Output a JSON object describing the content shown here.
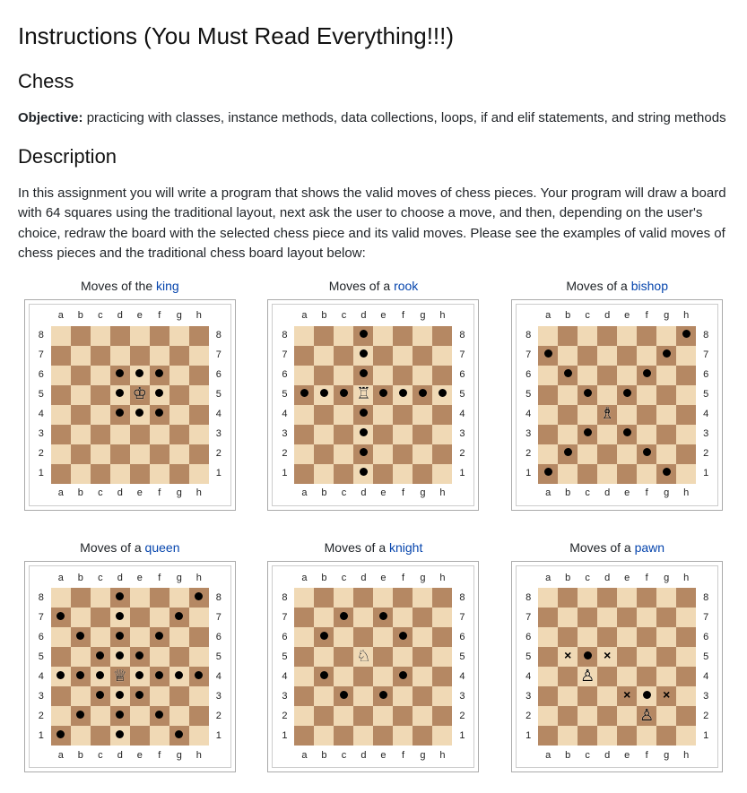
{
  "headings": {
    "main": "Instructions (You Must Read Everything!!!)",
    "chess": "Chess",
    "description": "Description"
  },
  "objective_label": "Objective:",
  "objective_text": " practicing with classes, instance methods, data collections, loops, if and elif statements, and string methods",
  "description_text": "In this assignment you will write a program that shows the valid moves of chess pieces. Your program will draw a board with 64 squares using the traditional layout, next ask the user to choose a move, and then, depending on the user's choice, redraw the board with the selected chess piece and its valid moves. Please see the examples of valid moves of chess pieces and the traditional chess board layout below:",
  "files": [
    "a",
    "b",
    "c",
    "d",
    "e",
    "f",
    "g",
    "h"
  ],
  "ranks": [
    "8",
    "7",
    "6",
    "5",
    "4",
    "3",
    "2",
    "1"
  ],
  "boards": [
    {
      "id": "king",
      "title_prefix": "Moves of the ",
      "title_link": "king",
      "piece_glyph": "♔",
      "piece_square": "e5",
      "dots": [
        "d6",
        "e6",
        "f6",
        "d5",
        "f5",
        "d4",
        "e4",
        "f4"
      ],
      "crosses": []
    },
    {
      "id": "rook",
      "title_prefix": "Moves of a ",
      "title_link": "rook",
      "piece_glyph": "♖",
      "piece_square": "d5",
      "dots": [
        "d8",
        "d7",
        "d6",
        "a5",
        "b5",
        "c5",
        "e5",
        "f5",
        "g5",
        "h5",
        "d4",
        "d3",
        "d2",
        "d1"
      ],
      "crosses": []
    },
    {
      "id": "bishop",
      "title_prefix": "Moves of a ",
      "title_link": "bishop",
      "piece_glyph": "♗",
      "piece_square": "d4",
      "dots": [
        "h8",
        "a7",
        "g7",
        "b6",
        "f6",
        "c5",
        "e5",
        "c3",
        "e3",
        "b2",
        "f2",
        "a1",
        "g1"
      ],
      "crosses": []
    },
    {
      "id": "queen",
      "title_prefix": "Moves of a ",
      "title_link": "queen",
      "piece_glyph": "♕",
      "piece_square": "d4",
      "dots": [
        "d8",
        "h8",
        "a7",
        "d7",
        "g7",
        "b6",
        "d6",
        "f6",
        "c5",
        "d5",
        "e5",
        "a4",
        "b4",
        "c4",
        "e4",
        "f4",
        "g4",
        "h4",
        "c3",
        "d3",
        "e3",
        "b2",
        "d2",
        "f2",
        "a1",
        "d1",
        "g1"
      ],
      "crosses": []
    },
    {
      "id": "knight",
      "title_prefix": "Moves of a ",
      "title_link": "knight",
      "piece_glyph": "♘",
      "piece_square": "d5",
      "dots": [
        "c7",
        "e7",
        "b6",
        "f6",
        "b4",
        "f4",
        "c3",
        "e3"
      ],
      "crosses": []
    },
    {
      "id": "pawn",
      "title_prefix": "Moves of a ",
      "title_link": "pawn",
      "piece_glyph_list": [
        "♙",
        "♙"
      ],
      "piece_squares": [
        "c4",
        "f2"
      ],
      "dots": [
        "c5",
        "f3"
      ],
      "crosses": [
        "b5",
        "d5",
        "e3",
        "g3"
      ]
    }
  ]
}
